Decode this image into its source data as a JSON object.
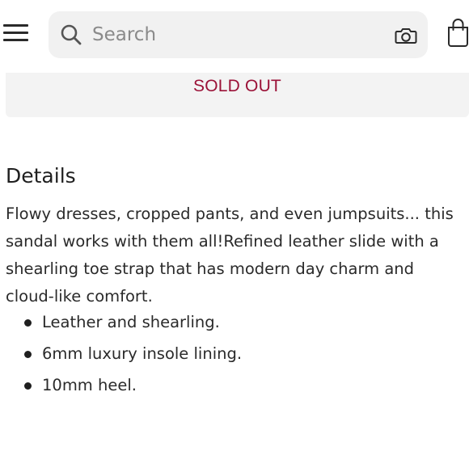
{
  "header": {
    "search": {
      "placeholder": "Search"
    },
    "icons": {
      "menu": "hamburger-menu-icon",
      "search": "search-icon",
      "camera": "camera-icon",
      "bag": "shopping-bag-icon"
    }
  },
  "product": {
    "status": "SOLD OUT",
    "status_color": "#9b1238"
  },
  "details": {
    "title": "Details",
    "description": "Flowy dresses, cropped pants, and even jumpsuits... this sandal works with them all!Refined leather slide with a shearling toe strap that has modern day charm and cloud-like comfort.",
    "bullets": [
      "Leather and shearling.",
      "6mm luxury insole lining.",
      "10mm heel."
    ]
  }
}
